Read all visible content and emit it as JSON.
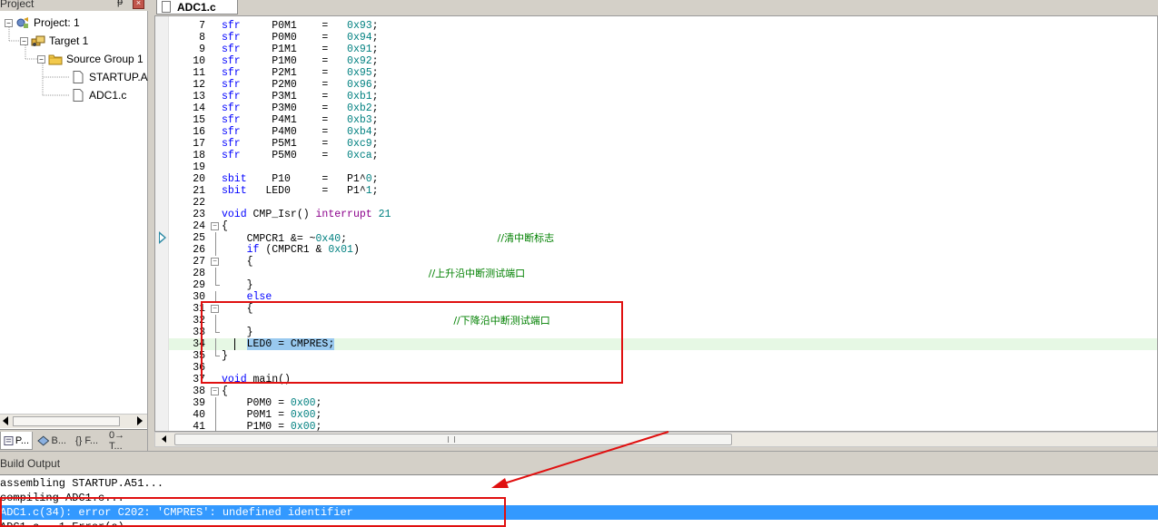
{
  "project": {
    "title": "Project",
    "pin_glyph": "ᵽ",
    "close_glyph": "×",
    "tree": [
      {
        "label": "Project: 1",
        "icon": "project-icon",
        "toggle": "−"
      },
      {
        "label": "Target 1",
        "icon": "target-icon",
        "toggle": "−"
      },
      {
        "label": "Source Group 1",
        "icon": "folder-icon",
        "toggle": "−"
      },
      {
        "label": "STARTUP.A",
        "icon": "file-icon"
      },
      {
        "label": "ADC1.c",
        "icon": "file-icon"
      }
    ],
    "tabs": [
      "P...",
      "B...",
      "{} F...",
      "0→ T..."
    ]
  },
  "editor": {
    "tab_label": "ADC1.c",
    "lines": [
      {
        "n": "7",
        "parts": [
          [
            "kw",
            "sfr"
          ],
          [
            "",
            "     P0M1    =   "
          ],
          [
            "num",
            "0x93"
          ],
          [
            "",
            ";"
          ]
        ]
      },
      {
        "n": "8",
        "parts": [
          [
            "kw",
            "sfr"
          ],
          [
            "",
            "     P0M0    =   "
          ],
          [
            "num",
            "0x94"
          ],
          [
            "",
            ";"
          ]
        ]
      },
      {
        "n": "9",
        "parts": [
          [
            "kw",
            "sfr"
          ],
          [
            "",
            "     P1M1    =   "
          ],
          [
            "num",
            "0x91"
          ],
          [
            "",
            ";"
          ]
        ]
      },
      {
        "n": "10",
        "parts": [
          [
            "kw",
            "sfr"
          ],
          [
            "",
            "     P1M0    =   "
          ],
          [
            "num",
            "0x92"
          ],
          [
            "",
            ";"
          ]
        ]
      },
      {
        "n": "11",
        "parts": [
          [
            "kw",
            "sfr"
          ],
          [
            "",
            "     P2M1    =   "
          ],
          [
            "num",
            "0x95"
          ],
          [
            "",
            ";"
          ]
        ]
      },
      {
        "n": "12",
        "parts": [
          [
            "kw",
            "sfr"
          ],
          [
            "",
            "     P2M0    =   "
          ],
          [
            "num",
            "0x96"
          ],
          [
            "",
            ";"
          ]
        ]
      },
      {
        "n": "13",
        "parts": [
          [
            "kw",
            "sfr"
          ],
          [
            "",
            "     P3M1    =   "
          ],
          [
            "num",
            "0xb1"
          ],
          [
            "",
            ";"
          ]
        ]
      },
      {
        "n": "14",
        "parts": [
          [
            "kw",
            "sfr"
          ],
          [
            "",
            "     P3M0    =   "
          ],
          [
            "num",
            "0xb2"
          ],
          [
            "",
            ";"
          ]
        ]
      },
      {
        "n": "15",
        "parts": [
          [
            "kw",
            "sfr"
          ],
          [
            "",
            "     P4M1    =   "
          ],
          [
            "num",
            "0xb3"
          ],
          [
            "",
            ";"
          ]
        ]
      },
      {
        "n": "16",
        "parts": [
          [
            "kw",
            "sfr"
          ],
          [
            "",
            "     P4M0    =   "
          ],
          [
            "num",
            "0xb4"
          ],
          [
            "",
            ";"
          ]
        ]
      },
      {
        "n": "17",
        "parts": [
          [
            "kw",
            "sfr"
          ],
          [
            "",
            "     P5M1    =   "
          ],
          [
            "num",
            "0xc9"
          ],
          [
            "",
            ";"
          ]
        ]
      },
      {
        "n": "18",
        "parts": [
          [
            "kw",
            "sfr"
          ],
          [
            "",
            "     P5M0    =   "
          ],
          [
            "num",
            "0xca"
          ],
          [
            "",
            ";"
          ]
        ]
      },
      {
        "n": "19",
        "parts": []
      },
      {
        "n": "20",
        "parts": [
          [
            "kw",
            "sbit"
          ],
          [
            "",
            "    P10     =   P1^"
          ],
          [
            "num",
            "0"
          ],
          [
            "",
            ";"
          ]
        ]
      },
      {
        "n": "21",
        "parts": [
          [
            "kw",
            "sbit"
          ],
          [
            "",
            "   LED0     =   P1^"
          ],
          [
            "num",
            "1"
          ],
          [
            "",
            ";"
          ]
        ]
      },
      {
        "n": "22",
        "parts": []
      },
      {
        "n": "23",
        "parts": [
          [
            "kw",
            "void"
          ],
          [
            "",
            " CMP_Isr() "
          ],
          [
            "kw2",
            "interrupt"
          ],
          [
            "",
            " "
          ],
          [
            "num",
            "21"
          ]
        ]
      },
      {
        "n": "24",
        "fold": "box",
        "parts": [
          [
            "",
            "{"
          ]
        ]
      },
      {
        "n": "25",
        "fold": "line",
        "parts": [
          [
            "",
            "    CMPCR1 &= ~"
          ],
          [
            "num",
            "0x40"
          ],
          [
            "",
            ";                        "
          ],
          [
            "cmt",
            "//清中断标志"
          ]
        ]
      },
      {
        "n": "26",
        "fold": "line",
        "parts": [
          [
            "",
            "    "
          ],
          [
            "kw",
            "if"
          ],
          [
            "",
            " (CMPCR1 & "
          ],
          [
            "num",
            "0x01"
          ],
          [
            "",
            ")"
          ]
        ]
      },
      {
        "n": "27",
        "fold": "box",
        "parts": [
          [
            "",
            "    {"
          ]
        ]
      },
      {
        "n": "28",
        "fold": "line",
        "parts": [
          [
            "",
            "                                 "
          ],
          [
            "cmt",
            "//上升沿中断测试端口"
          ]
        ]
      },
      {
        "n": "29",
        "fold": "end",
        "parts": [
          [
            "",
            "    }"
          ]
        ]
      },
      {
        "n": "30",
        "fold": "line",
        "parts": [
          [
            "",
            "    "
          ],
          [
            "kw",
            "else"
          ]
        ]
      },
      {
        "n": "31",
        "fold": "box",
        "parts": [
          [
            "",
            "    {"
          ]
        ]
      },
      {
        "n": "32",
        "fold": "line",
        "parts": [
          [
            "",
            "                                     "
          ],
          [
            "cmt",
            "//下降沿中断测试端口"
          ]
        ]
      },
      {
        "n": "33",
        "fold": "end",
        "parts": [
          [
            "",
            "    }"
          ]
        ]
      },
      {
        "n": "34",
        "fold": "line",
        "hl": true,
        "cursor": true,
        "parts": [
          [
            "",
            "    "
          ],
          [
            "sel",
            "LED0 = CMPRES;"
          ]
        ]
      },
      {
        "n": "35",
        "fold": "end",
        "parts": [
          [
            "",
            "}"
          ]
        ]
      },
      {
        "n": "36",
        "parts": []
      },
      {
        "n": "37",
        "parts": [
          [
            "kw",
            "void"
          ],
          [
            "",
            " main()"
          ]
        ]
      },
      {
        "n": "38",
        "fold": "box",
        "parts": [
          [
            "",
            "{"
          ]
        ]
      },
      {
        "n": "39",
        "fold": "line",
        "parts": [
          [
            "",
            "    P0M0 = "
          ],
          [
            "num",
            "0x00"
          ],
          [
            "",
            ";"
          ]
        ]
      },
      {
        "n": "40",
        "fold": "line",
        "parts": [
          [
            "",
            "    P0M1 = "
          ],
          [
            "num",
            "0x00"
          ],
          [
            "",
            ";"
          ]
        ]
      },
      {
        "n": "41",
        "fold": "line",
        "parts": [
          [
            "",
            "    P1M0 = "
          ],
          [
            "num",
            "0x00"
          ],
          [
            "",
            ";"
          ]
        ]
      }
    ]
  },
  "build": {
    "title": "Build Output",
    "lines": [
      {
        "text": "assembling STARTUP.A51...",
        "error": false
      },
      {
        "text": "compiling ADC1.c...",
        "error": false
      },
      {
        "text": "ADC1.c(34): error C202: 'CMPRES': undefined identifier",
        "error": true
      },
      {
        "text": "ADC1.c - 1 Error(s)",
        "error": false
      }
    ]
  },
  "colors": {
    "accent_red": "#e01010",
    "selection_blue": "#3399ff",
    "keyword": "#0000ff",
    "number": "#008080",
    "comment": "#008000"
  }
}
